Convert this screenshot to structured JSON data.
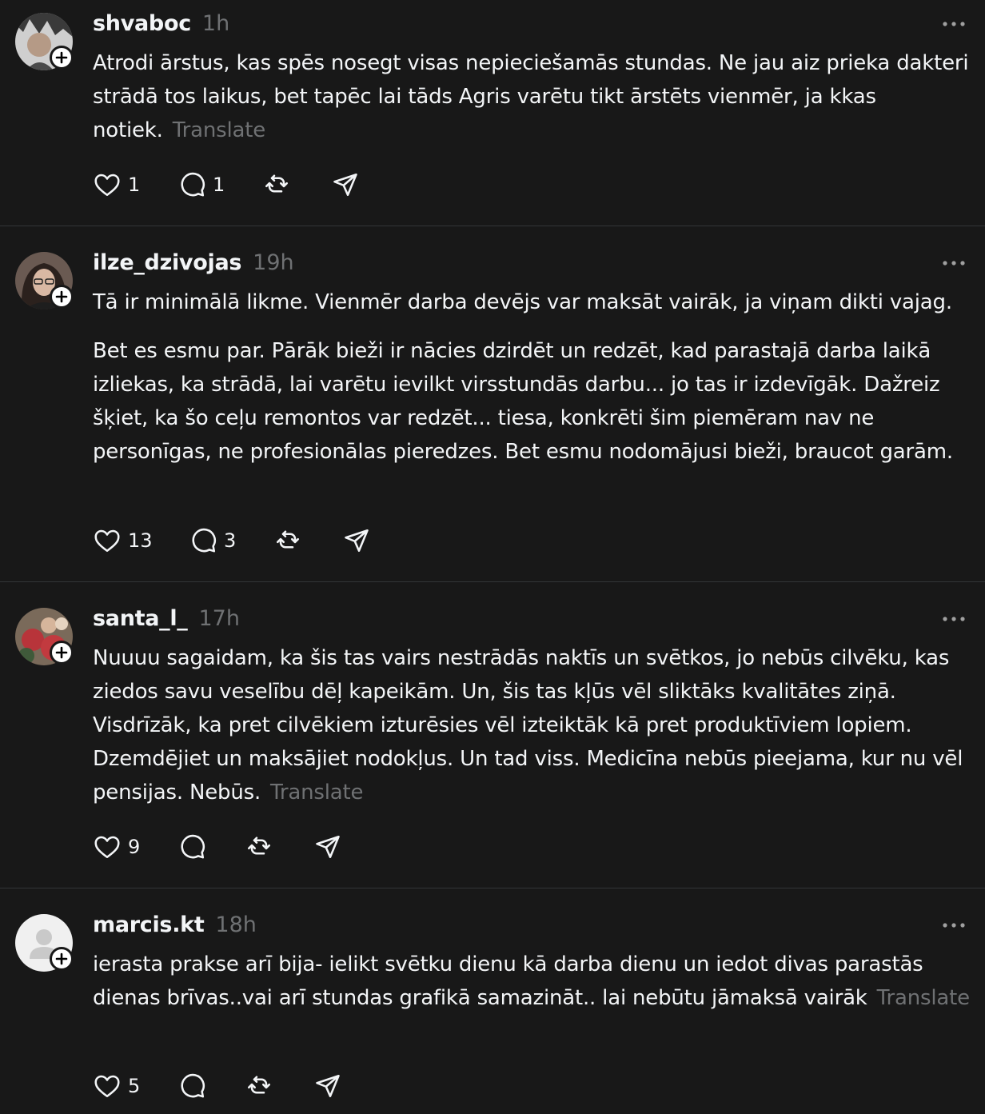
{
  "posts": [
    {
      "username": "shvaboc",
      "time": "1h",
      "paragraphs": [
        "Atrodi ārstus, kas spēs nosegt visas nepieciešamās stundas. Ne jau aiz prieka dakteri strādā tos laikus, bet tapēc lai tāds Agris varētu tikt ārstēts vienmēr, ja kkas notiek."
      ],
      "translate": "Translate",
      "likes": "1",
      "replies": "1",
      "avatar": "user-photo"
    },
    {
      "username": "ilze_dzivojas",
      "time": "19h",
      "paragraphs": [
        "Tā ir minimālā likme. Vienmēr darba devējs var maksāt vairāk, ja viņam dikti vajag.",
        "Bet es esmu par. Pārāk bieži ir nācies dzirdēt un redzēt, kad parastajā darba laikā izliekas, ka strādā, lai varētu ievilkt virsstundās darbu... jo tas ir izdevīgāk. Dažreiz šķiet, ka šo ceļu remontos var redzēt... tiesa, konkrēti šim piemēram nav ne personīgas, ne profesionālas pieredzes. Bet esmu nodomājusi bieži, braucot garām."
      ],
      "translate": "",
      "likes": "13",
      "replies": "3",
      "avatar": "user-photo"
    },
    {
      "username": "santa_l_",
      "time": "17h",
      "paragraphs": [
        "Nuuuu sagaidam, ka šis tas vairs nestrādās naktīs un svētkos, jo nebūs cilvēku, kas ziedos savu veselību dēļ kapeikām. Un, šis tas kļūs vēl sliktāks kvalitātes ziņā. Visdrīzāk, ka pret cilvēkiem izturēsies vēl izteiktāk kā pret produktīviem lopiem. Dzemdējiet un maksājiet nodokļus. Un tad viss. Medicīna nebūs pieejama, kur nu vēl pensijas. Nebūs."
      ],
      "translate": "Translate",
      "likes": "9",
      "replies": "",
      "avatar": "user-photo"
    },
    {
      "username": "marcis.kt",
      "time": "18h",
      "paragraphs": [
        "ierasta prakse arī bija- ielikt svētku dienu kā darba dienu un iedot divas parastās dienas brīvas..vai arī stundas grafikā samazināt.. lai nebūtu jāmaksā vairāk"
      ],
      "translate": "Translate",
      "likes": "5",
      "replies": "",
      "avatar": "default-person-icon"
    }
  ],
  "icons": {
    "like": "heart-icon",
    "reply": "comment-icon",
    "repost": "repost-icon",
    "share": "send-icon",
    "more": "more-dots-icon",
    "follow": "plus-icon"
  },
  "colors": {
    "background": "#181818",
    "text": "#f3f5f7",
    "muted": "#6f7173",
    "divider": "#333638"
  }
}
